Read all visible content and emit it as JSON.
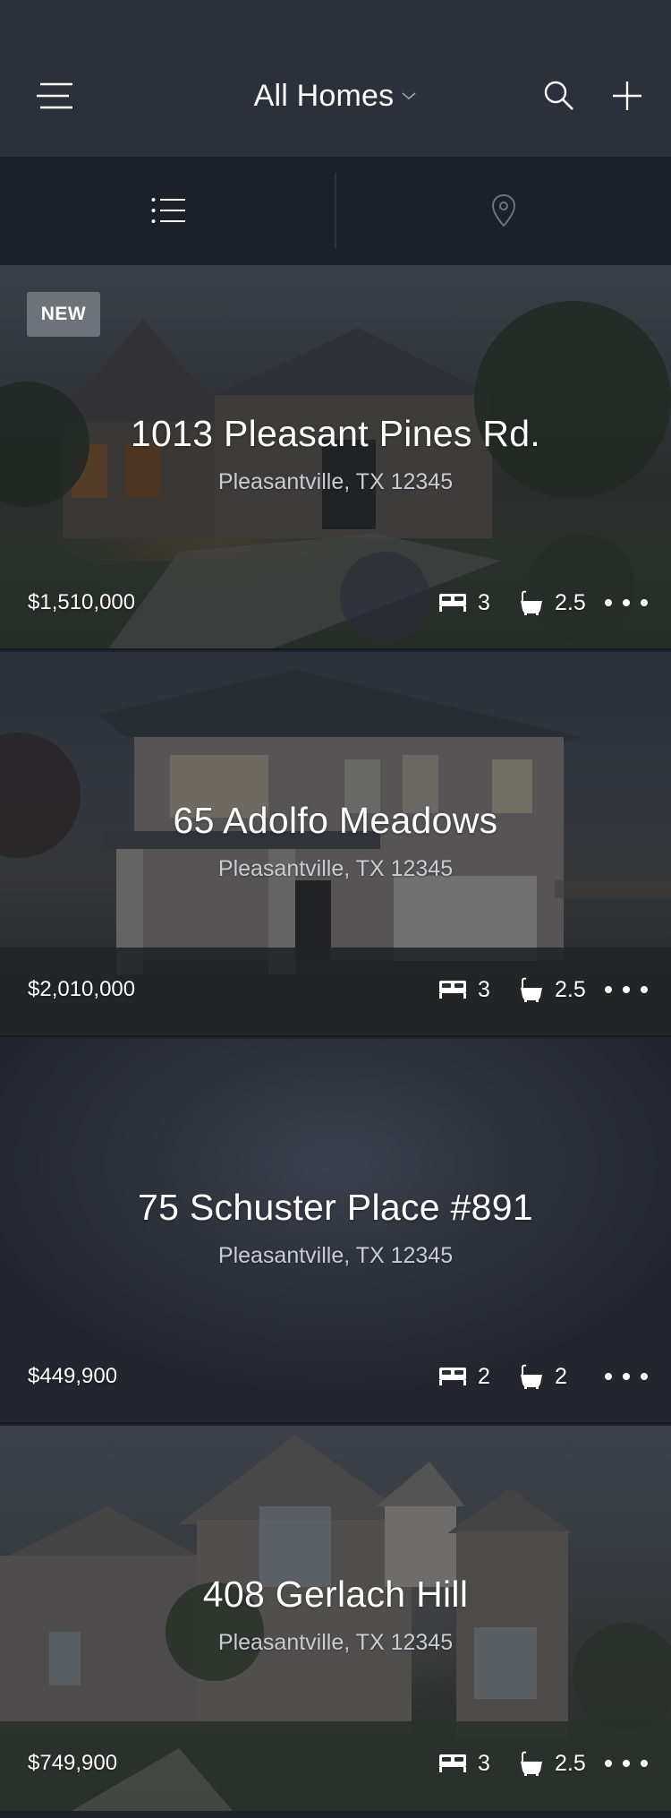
{
  "header": {
    "title": "All Homes"
  },
  "view_toggle": {
    "list_icon": "list-icon",
    "map_icon": "map-pin-icon"
  },
  "listings": [
    {
      "badge": "NEW",
      "address": "1013 Pleasant Pines Rd.",
      "city": "Pleasantville, TX 12345",
      "price": "$1,510,000",
      "beds": "3",
      "baths": "2.5"
    },
    {
      "badge": "",
      "address": "65 Adolfo Meadows",
      "city": "Pleasantville, TX 12345",
      "price": "$2,010,000",
      "beds": "3",
      "baths": "2.5"
    },
    {
      "badge": "",
      "address": "75 Schuster Place #891",
      "city": "Pleasantville, TX 12345",
      "price": "$449,900",
      "beds": "2",
      "baths": "2"
    },
    {
      "badge": "",
      "address": "408 Gerlach Hill",
      "city": "Pleasantville, TX 12345",
      "price": "$749,900",
      "beds": "3",
      "baths": "2.5"
    }
  ],
  "colors": {
    "header_bg": "#2b303b",
    "toggle_bg": "#1c202a",
    "text": "#ffffff",
    "subtext": "#c9ccd3"
  }
}
